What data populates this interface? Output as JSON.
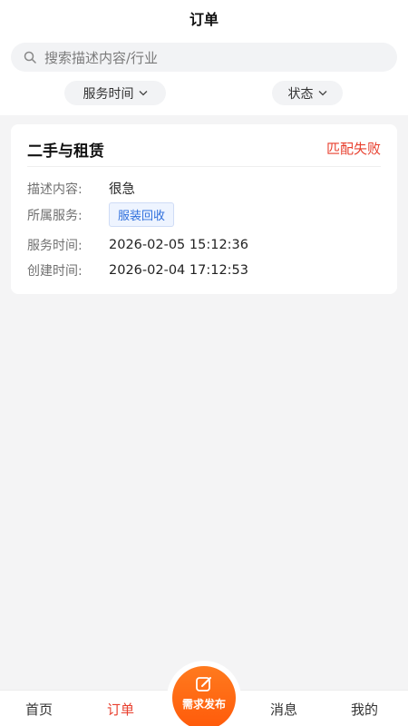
{
  "header": {
    "title": "订单"
  },
  "search": {
    "placeholder": "搜索描述内容/行业"
  },
  "filters": [
    {
      "label": "服务时间"
    },
    {
      "label": "状态"
    }
  ],
  "order": {
    "category": "二手与租赁",
    "status": "匹配失败",
    "fields": {
      "description_label": "描述内容:",
      "description_value": "很急",
      "service_label": "所属服务:",
      "service_tag": "服装回收",
      "service_time_label": "服务时间:",
      "service_time_value": "2026-02-05 15:12:36",
      "created_label": "创建时间:",
      "created_value": "2026-02-04 17:12:53"
    }
  },
  "tabbar": {
    "items": [
      {
        "label": "首页"
      },
      {
        "label": "订单"
      },
      {
        "label": "消息"
      },
      {
        "label": "我的"
      }
    ],
    "publish_label": "需求发布",
    "active": "订单"
  },
  "colors": {
    "accent": "#e8402f",
    "publish": "#ff6a14",
    "tag": "#2f6fdc"
  },
  "icons": [
    "search-icon",
    "chevron-down-icon",
    "edit-icon"
  ]
}
